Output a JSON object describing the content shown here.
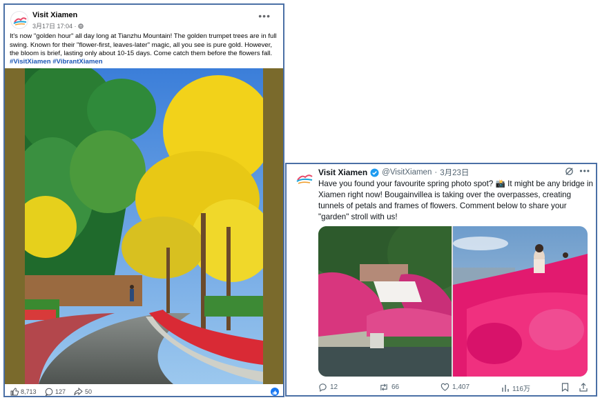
{
  "facebook_post": {
    "author": "Visit Xiamen",
    "date": "3月17日 17:04 · ",
    "more_icon": "more-horizontal-icon",
    "body": "It's now \"golden hour\" all day long at Tianzhu Mountain! The golden trumpet trees are in full swing. Known for their \"flower-first, leaves-later\" magic, all you see is pure gold. However, the bloom is brief, lasting only about 10-15 days. Come catch them before the flowers fall.",
    "hashtags": "#VisitXiamen #VibrantXiamen",
    "image_description": "golden-trumpet-tree-lined-path",
    "stats": {
      "likes": "8,713",
      "comments": "127",
      "shares": "50"
    },
    "colors": {
      "hashtag": "#1b56b6",
      "like_badge": "#1877f2"
    }
  },
  "x_post": {
    "author": "Visit Xiamen",
    "handle": "@VisitXiamen",
    "separator": " · ",
    "date": "3月23日",
    "body": "Have you found your favourite spring photo spot? 📸 It might be any bridge in Xiamen right now! Bougainvillea is taking over the overpasses, creating tunnels of petals and frames of flowers. Comment below to share your \"garden\" stroll with us!",
    "actions": {
      "replies": "12",
      "reposts": "66",
      "likes": "1,407",
      "views": "116万"
    },
    "colors": {
      "verified": "#1d9bf0",
      "text": "#0f1419",
      "secondary": "#536471"
    }
  }
}
